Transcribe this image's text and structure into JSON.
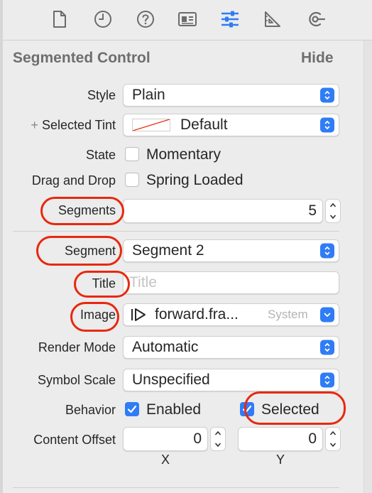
{
  "inspector_tabs": [
    {
      "name": "file-inspector-tab",
      "icon": "file-icon"
    },
    {
      "name": "history-inspector-tab",
      "icon": "clock-icon"
    },
    {
      "name": "quick-help-tab",
      "icon": "question-icon"
    },
    {
      "name": "identity-inspector-tab",
      "icon": "id-card-icon"
    },
    {
      "name": "attributes-inspector-tab",
      "icon": "sliders-icon",
      "selected": true
    },
    {
      "name": "size-inspector-tab",
      "icon": "ruler-icon"
    },
    {
      "name": "connections-inspector-tab",
      "icon": "connections-icon"
    }
  ],
  "section": {
    "title": "Segmented Control",
    "hide_label": "Hide"
  },
  "fields": {
    "style": {
      "label": "Style",
      "value": "Plain"
    },
    "selected_tint": {
      "add": "+",
      "label": "Selected Tint",
      "value": "Default"
    },
    "state": {
      "label": "State",
      "checkbox_label": "Momentary",
      "checked": false
    },
    "drag_drop": {
      "label": "Drag and Drop",
      "checkbox_label": "Spring Loaded",
      "checked": false
    },
    "segments": {
      "label": "Segments",
      "value": "5"
    },
    "segment": {
      "label": "Segment",
      "value": "Segment 2"
    },
    "title": {
      "label": "Title",
      "placeholder": "Title"
    },
    "image": {
      "label": "Image",
      "value": "forward.fra...",
      "source": "System"
    },
    "render_mode": {
      "label": "Render Mode",
      "value": "Automatic"
    },
    "symbol_scale": {
      "label": "Symbol Scale",
      "value": "Unspecified"
    },
    "behavior": {
      "label": "Behavior",
      "enabled_label": "Enabled",
      "enabled_checked": true,
      "selected_label": "Selected",
      "selected_checked": true
    },
    "content_offset": {
      "label": "Content Offset",
      "x_value": "0",
      "y_value": "0",
      "x_label": "X",
      "y_label": "Y"
    }
  },
  "colors": {
    "accent": "#2f7cf6",
    "highlight_ring": "#e8280f",
    "tab_selected": "#2f7cf6",
    "tab_icon": "#6b6b6b"
  }
}
